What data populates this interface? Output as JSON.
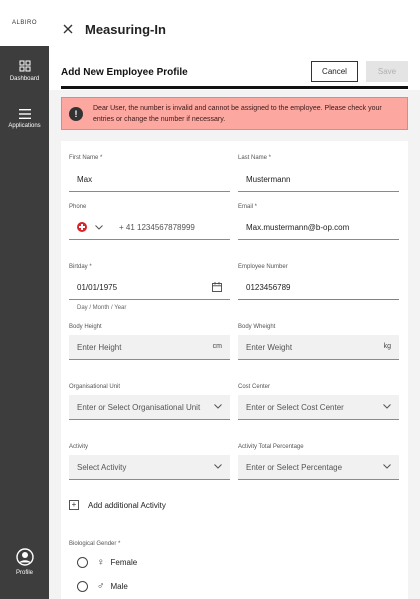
{
  "sidebar": {
    "logo": "ALBIRO",
    "items": [
      {
        "label": "Dashboard",
        "icon": "dashboard-icon"
      },
      {
        "label": "Applications",
        "icon": "menu-icon"
      }
    ],
    "profile_label": "Profile"
  },
  "header": {
    "title": "Measuring-In"
  },
  "page": {
    "title": "Add New Employee Profile",
    "cancel_label": "Cancel",
    "save_label": "Save"
  },
  "alert": {
    "text": "Dear User, the number is invalid and cannot be assigned to the employee. Please check your entries or change the number if necessary.",
    "color": "#fca7a0"
  },
  "form": {
    "first_name": {
      "label": "First Name *",
      "value": "Max"
    },
    "last_name": {
      "label": "Last Name *",
      "value": "Mustermann"
    },
    "phone": {
      "label": "Phone",
      "value": "+ 41 1234567878999"
    },
    "email": {
      "label": "Email *",
      "value": "Max.mustermann@b-op.com"
    },
    "birthday": {
      "label": "Birtday *",
      "value": "01/01/1975",
      "hint": "Day / Month / Year"
    },
    "employee_number": {
      "label": "Employee Number",
      "value": "0123456789"
    },
    "body_height": {
      "label": "Body Height",
      "placeholder": "Enter Height",
      "unit": "cm"
    },
    "body_weight": {
      "label": "Body Wheight",
      "placeholder": "Enter Weight",
      "unit": "kg"
    },
    "org_unit": {
      "label": "Organisational Unit",
      "placeholder": "Enter or Select Organisational Unit"
    },
    "cost_center": {
      "label": "Cost Center",
      "placeholder": "Enter or Select Cost Center"
    },
    "activity": {
      "label": "Activity",
      "placeholder": "Select Activity"
    },
    "activity_pct": {
      "label": "Activity Total Percentage",
      "placeholder": "Enter or Select Percentage"
    },
    "add_activity_label": "Add additional Activity",
    "gender": {
      "label": "Biological Gender *",
      "options": [
        {
          "label": "Female",
          "symbol": "♀"
        },
        {
          "label": "Male",
          "symbol": "♂"
        }
      ]
    }
  }
}
